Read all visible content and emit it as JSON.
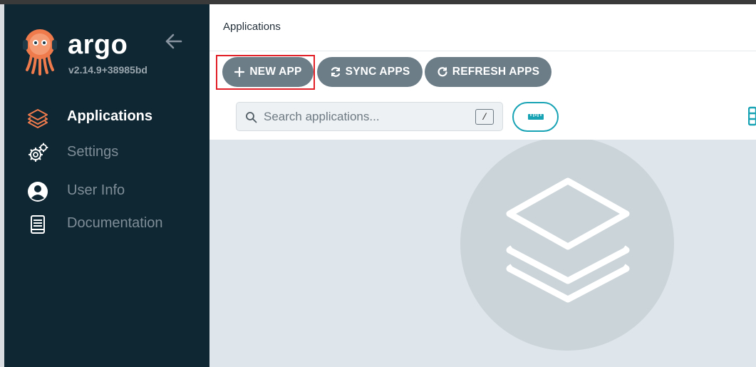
{
  "sidebar": {
    "brand": "argo",
    "version": "v2.14.9+38985bd",
    "items": [
      {
        "label": "Applications",
        "icon": "layers-icon",
        "active": true
      },
      {
        "label": "Settings",
        "icon": "gears-icon",
        "active": false
      },
      {
        "label": "User Info",
        "icon": "user-circle-icon",
        "active": false
      },
      {
        "label": "Documentation",
        "icon": "book-icon",
        "active": false
      }
    ]
  },
  "header": {
    "title": "Applications"
  },
  "toolbar": {
    "new_app": "NEW APP",
    "sync_apps": "SYNC APPS",
    "refresh_apps": "REFRESH APPS"
  },
  "search": {
    "placeholder": "Search applications...",
    "shortcut": "/"
  },
  "colors": {
    "sidebar_bg": "#0f2733",
    "button_bg": "#6c7d88",
    "accent_teal": "#18a3b5",
    "highlight_red": "#e21f26",
    "logo_orange": "#ef7b4d"
  }
}
